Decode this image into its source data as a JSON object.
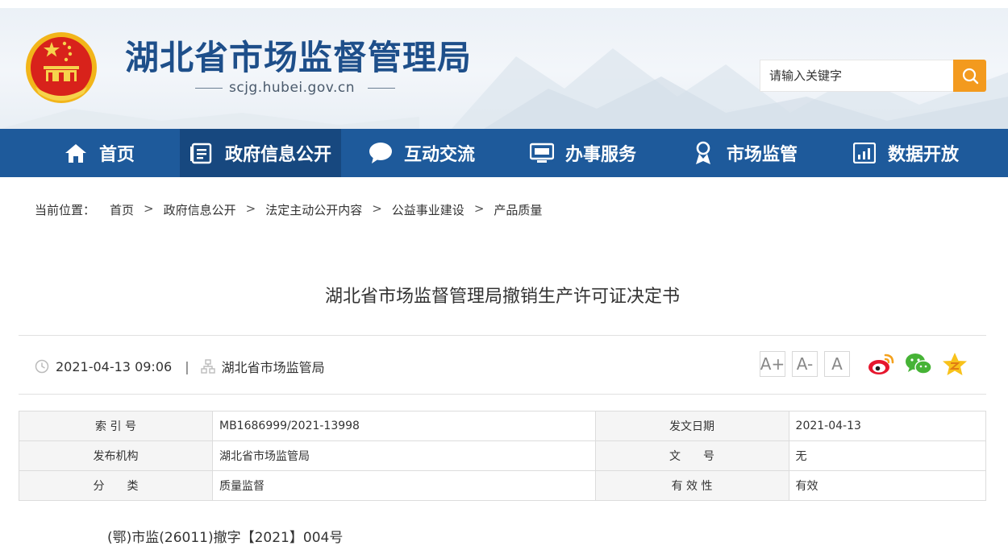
{
  "header": {
    "site_title": "湖北省市场监督管理局",
    "site_domain": "scjg.hubei.gov.cn",
    "search_placeholder": "请输入关键字",
    "search_icon": "search-icon",
    "emblem": "national-emblem"
  },
  "colors": {
    "nav_bg": "#1e5a9b",
    "nav_active": "#17487f",
    "title_blue": "#1e4f8a",
    "search_btn": "#f39a1e"
  },
  "nav": {
    "items": [
      {
        "label": "首页",
        "icon": "home-icon",
        "active": false
      },
      {
        "label": "政府信息公开",
        "icon": "document-list-icon",
        "active": true
      },
      {
        "label": "互动交流",
        "icon": "chat-bubble-icon",
        "active": false
      },
      {
        "label": "办事服务",
        "icon": "monitor-icon",
        "active": false
      },
      {
        "label": "市场监管",
        "icon": "inspector-badge-icon",
        "active": false
      },
      {
        "label": "数据开放",
        "icon": "bar-chart-icon",
        "active": false
      }
    ]
  },
  "breadcrumb": {
    "lead": "当前位置：",
    "separator": ">",
    "items": [
      "首页",
      "政府信息公开",
      "法定主动公开内容",
      "公益事业建设",
      "产品质量"
    ]
  },
  "article": {
    "title": "湖北省市场监督管理局撤销生产许可证决定书",
    "datetime": "2021-04-13 09:06",
    "meta_separator": "|",
    "source": "湖北省市场监管局",
    "font_sizes": [
      "A+",
      "A-",
      "A"
    ],
    "share_icons": [
      "weibo-icon",
      "wechat-icon",
      "qzone-icon"
    ],
    "doc_number": "(鄂)市监(26011)撤字【2021】004号"
  },
  "info_table": {
    "rows": [
      {
        "k1": "索 引 号",
        "v1": "MB1686999/2021-13998",
        "k2": "发文日期",
        "v2": "2021-04-13"
      },
      {
        "k1": "发布机构",
        "v1": "湖北省市场监管局",
        "k2": "文　　号",
        "v2": "无"
      },
      {
        "k1": "分　　类",
        "v1": "质量监督",
        "k2": "有 效 性",
        "v2": "有效"
      }
    ]
  }
}
